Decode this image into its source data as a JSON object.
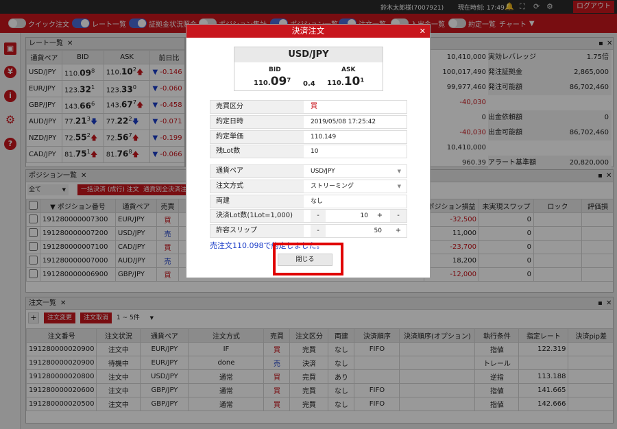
{
  "topbar": {
    "user": "鈴木太郎様(7007921)",
    "time_label": "現在時刻: 17:49",
    "logout": "ログアウト"
  },
  "toolbar": {
    "items": [
      {
        "label": "クイック注文",
        "on": false
      },
      {
        "label": "レート一覧",
        "on": true
      },
      {
        "label": "証拠金状況照会",
        "on": true
      },
      {
        "label": "ポジション集計",
        "on": false
      },
      {
        "label": "ポジション一覧",
        "on": true
      },
      {
        "label": "注文一覧",
        "on": true
      },
      {
        "label": "入出金一覧",
        "on": false
      },
      {
        "label": "約定一覧",
        "on": false
      }
    ],
    "chart": "チャート"
  },
  "rates": {
    "title": "レート一覧",
    "headers": [
      "通貨ペア",
      "BID",
      "ASK",
      "前日比",
      "Op"
    ],
    "rows": [
      {
        "pair": "USD/JPY",
        "bid_a": "110.",
        "bid_b": "09",
        "bid_c": "8",
        "ask_a": "110.",
        "ask_b": "10",
        "ask_c": "2",
        "chg": "-0.146",
        "dir": "up"
      },
      {
        "pair": "EUR/JPY",
        "bid_a": "123.",
        "bid_b": "32",
        "bid_c": "1",
        "ask_a": "123.",
        "ask_b": "33",
        "ask_c": "0",
        "chg": "-0.060",
        "dir": "none"
      },
      {
        "pair": "GBP/JPY",
        "bid_a": "143.",
        "bid_b": "66",
        "bid_c": "6",
        "ask_a": "143.",
        "ask_b": "67",
        "ask_c": "7",
        "chg": "-0.458",
        "dir": "up"
      },
      {
        "pair": "AUD/JPY",
        "bid_a": "77.",
        "bid_b": "21",
        "bid_c": "3",
        "ask_a": "77.",
        "ask_b": "22",
        "ask_c": "2",
        "chg": "-0.071",
        "dir": "down"
      },
      {
        "pair": "NZD/JPY",
        "bid_a": "72.",
        "bid_b": "55",
        "bid_c": "2",
        "ask_a": "72.",
        "ask_b": "56",
        "ask_c": "7",
        "chg": "-0.199",
        "dir": "up"
      },
      {
        "pair": "CAD/JPY",
        "bid_a": "81.",
        "bid_b": "75",
        "bid_c": "1",
        "ask_a": "81.",
        "ask_b": "76",
        "ask_c": "8",
        "chg": "-0.066",
        "dir": "up"
      }
    ]
  },
  "margin": {
    "left_values": [
      "10,410,000",
      "100,017,490",
      "99,977,460",
      "-40,030",
      "0",
      "-40,030",
      "10,410,000",
      "960.39"
    ],
    "right_labels": [
      "実効レバレッジ",
      "発注証拠金",
      "発注可能額",
      "",
      "出金依頼額",
      "出金可能額",
      "",
      "アラート基準額"
    ],
    "right_values": [
      "1.75倍",
      "2,865,000",
      "86,702,460",
      "",
      "0",
      "86,702,460",
      "",
      "20,820,000"
    ]
  },
  "positions": {
    "title": "ポジション一覧",
    "filter": "全て",
    "btn1": "一括決済 (成行) 注文",
    "btn2": "通貨別全決済注",
    "headers": [
      "▼ ポジション番号",
      "通貨ペア",
      "売買",
      "ポジション損益",
      "未実現スワップ",
      "ロック",
      "評価損"
    ],
    "rows": [
      {
        "no": "191280000007300",
        "pair": "EUR/JPY",
        "side": "買",
        "pl": "-32,500",
        "swap": "0"
      },
      {
        "no": "191280000007200",
        "pair": "USD/JPY",
        "side": "売",
        "pl": "11,000",
        "swap": "0"
      },
      {
        "no": "191280000007100",
        "pair": "CAD/JPY",
        "side": "買",
        "pl": "-23,700",
        "swap": "0"
      },
      {
        "no": "191280000007000",
        "pair": "AUD/JPY",
        "side": "売",
        "pl": "18,200",
        "swap": "0"
      },
      {
        "no": "191280000006900",
        "pair": "GBP/JPY",
        "side": "買",
        "pl": "-12,000",
        "swap": "0"
      }
    ]
  },
  "orders": {
    "title": "注文一覧",
    "btn_change": "注文変更",
    "btn_cancel": "注文取消",
    "range": "1 ~ 5件",
    "headers": [
      "注文番号",
      "注文状況",
      "通貨ペア",
      "注文方式",
      "売買",
      "注文区分",
      "両建",
      "決済順序",
      "決済順序(オプション)",
      "執行条件",
      "指定レート",
      "決済pip差"
    ],
    "rows": [
      {
        "no": "191280000020900",
        "st": "注文中",
        "pair": "EUR/JPY",
        "method": "IF",
        "side": "買",
        "kind": "完買",
        "ryo": "なし",
        "order": "FIFO",
        "cond": "指値",
        "rate": "122.319"
      },
      {
        "no": "191280000020900",
        "st": "待機中",
        "pair": "EUR/JPY",
        "method": "done",
        "side": "売",
        "kind": "決済",
        "ryo": "なし",
        "order": "",
        "cond": "トレール",
        "rate": ""
      },
      {
        "no": "191280000020800",
        "st": "注文中",
        "pair": "USD/JPY",
        "method": "通常",
        "side": "買",
        "kind": "完買",
        "ryo": "あり",
        "order": "",
        "cond": "逆指",
        "rate": "113.188"
      },
      {
        "no": "191280000020600",
        "st": "注文中",
        "pair": "GBP/JPY",
        "method": "通常",
        "side": "買",
        "kind": "完買",
        "ryo": "なし",
        "order": "FIFO",
        "cond": "指値",
        "rate": "141.665"
      },
      {
        "no": "191280000020500",
        "st": "注文中",
        "pair": "GBP/JPY",
        "method": "通常",
        "side": "買",
        "kind": "完買",
        "ryo": "なし",
        "order": "FIFO",
        "cond": "指値",
        "rate": "142.666"
      }
    ]
  },
  "dialog": {
    "title": "決済注文",
    "pair": "USD/JPY",
    "bid_label": "BID",
    "ask_label": "ASK",
    "bid_a": "110.",
    "bid_b": "09",
    "bid_c": "7",
    "spread": "0.4",
    "ask_a": "110.",
    "ask_b": "10",
    "ask_c": "1",
    "fields": [
      {
        "label": "売買区分",
        "value": "買"
      },
      {
        "label": "約定日時",
        "value": "2019/05/08 17:25:42"
      },
      {
        "label": "約定単価",
        "value": "110.149"
      },
      {
        "label": "残Lot数",
        "value": "10"
      }
    ],
    "pair_label": "通貨ペア",
    "pair_value": "USD/JPY",
    "method_label": "注文方式",
    "method_value": "ストリーミング",
    "ryo_label": "両建",
    "ryo_value": "なし",
    "lot_label": "決済Lot数(1Lot=1,000)",
    "lot_value": "10",
    "slip_label": "許容スリップ",
    "slip_value": "50",
    "message": "売注文110.098で約定しました。",
    "close": "閉じる"
  }
}
